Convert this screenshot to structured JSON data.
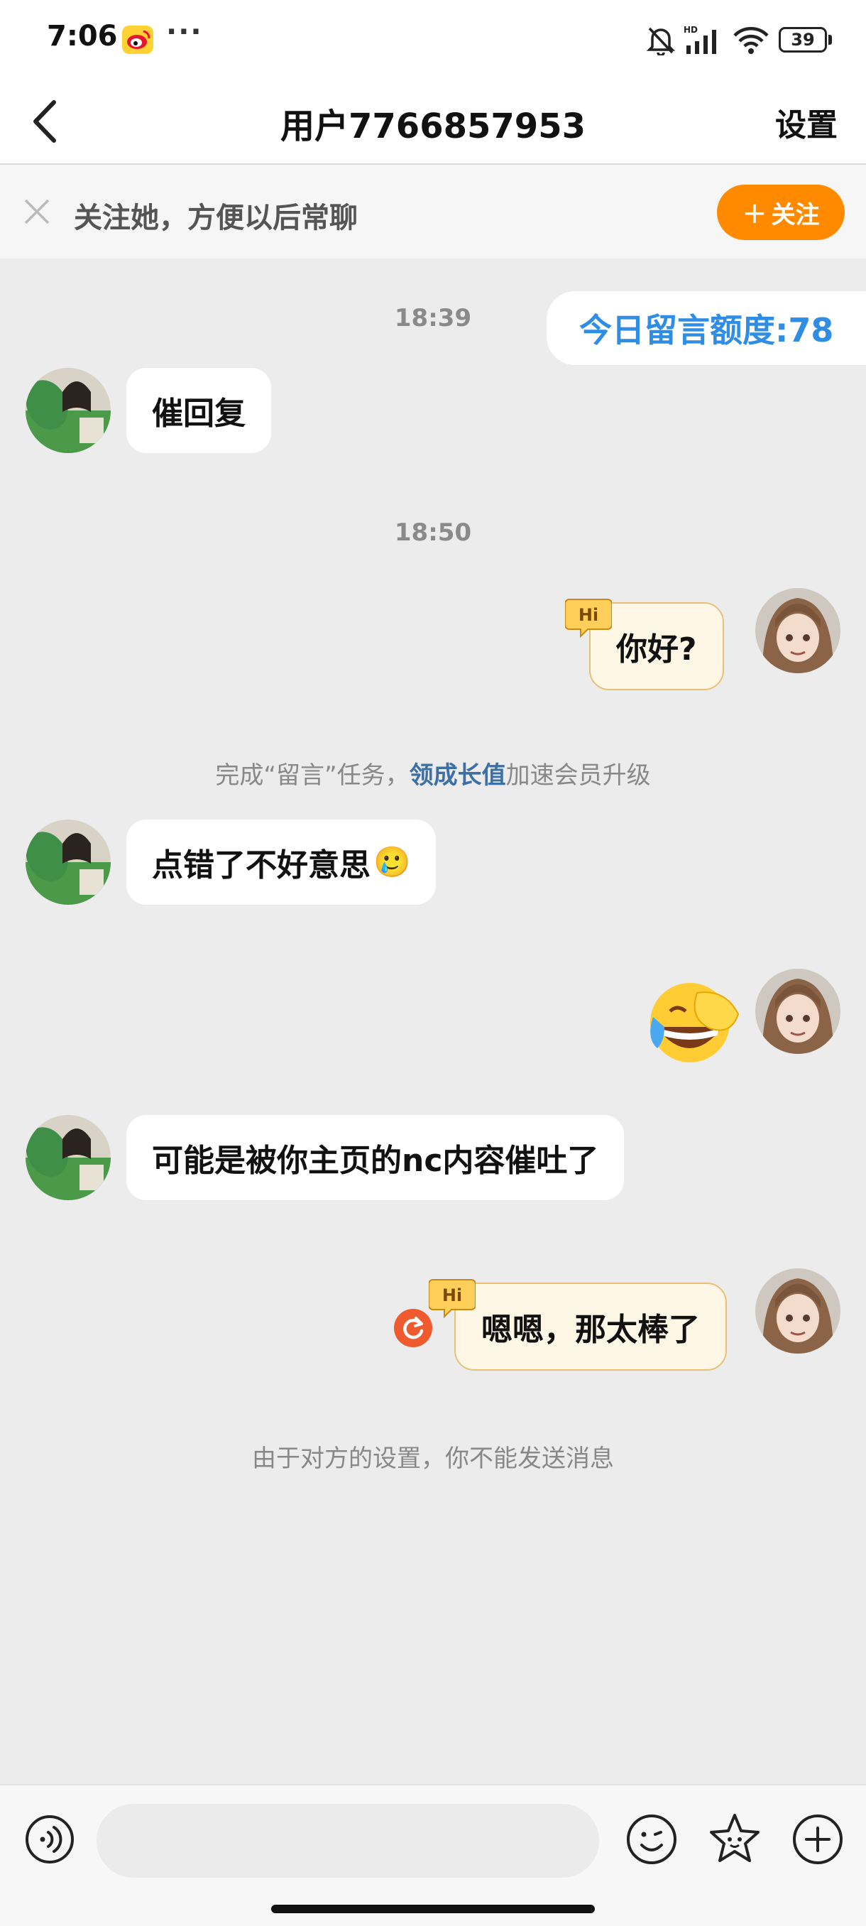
{
  "status_bar": {
    "time": "7:06",
    "more": "···",
    "battery": "39",
    "network": "HD"
  },
  "header": {
    "back_label": "<",
    "title": "用户7766857953",
    "settings_label": "设置"
  },
  "banner": {
    "text": "关注她，方便以后常聊",
    "follow_label": "关注",
    "follow_plus": "+"
  },
  "messages": {
    "quota": "今日留言额度:78",
    "time1": "18:39",
    "msg1": "催回复",
    "time2": "18:50",
    "msg2": "你好?",
    "task_note_prefix": "完成“留言”任务，",
    "task_note_link": "领成长值",
    "task_note_suffix": "加速会员升级",
    "msg3": "点错了不好意思",
    "msg3_emoji": "🥲",
    "msg4_emoji": "😂",
    "msg5": "可能是被你主页的nc内容催吐了",
    "msg6": "嗯嗯，那太棒了",
    "hi_badge": "Hi",
    "blocked_note": "由于对方的设置，你不能发送消息"
  },
  "input": {
    "placeholder": ""
  },
  "colors": {
    "accent_orange": "#ff8a00",
    "link_blue": "#3b6fa6",
    "quota_blue": "#2f8de4",
    "retry_red": "#ef5a2f"
  }
}
